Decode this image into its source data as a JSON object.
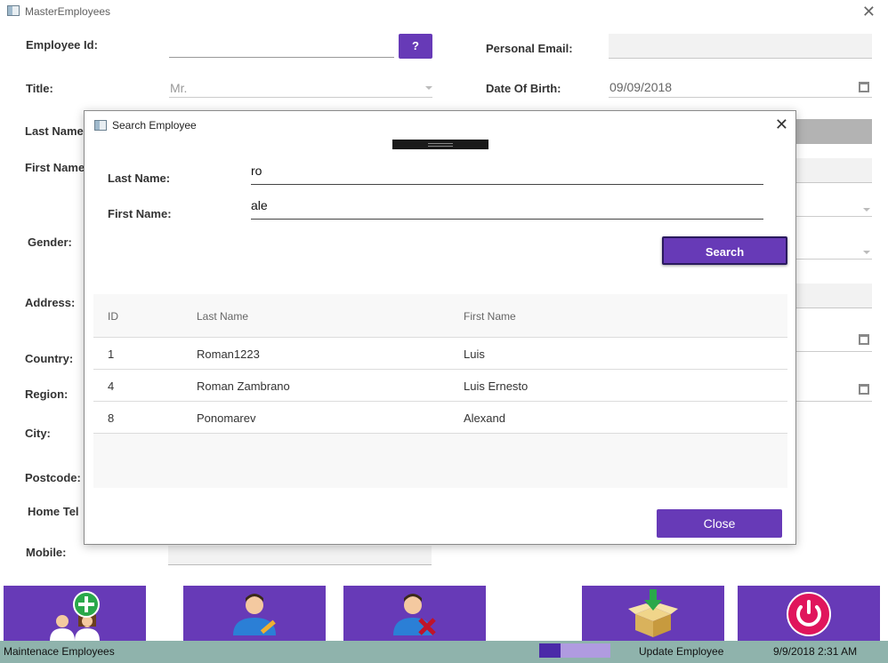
{
  "window": {
    "title": "MasterEmployees"
  },
  "form": {
    "employee_id_label": "Employee Id:",
    "lookup_button": "?",
    "title_label": "Title:",
    "title_value": "Mr.",
    "last_name_label": "Last Name",
    "first_name_label": "First Name",
    "gender_label": "Gender:",
    "address_label": "Address:",
    "country_label": "Country:",
    "region_label": "Region:",
    "city_label": "City:",
    "postcode_label": "Postcode:",
    "home_tel_label": "Home Tel",
    "mobile_label": "Mobile:",
    "personal_email_label": "Personal Email:",
    "dob_label": "Date Of Birth:",
    "dob_value": "09/09/2018"
  },
  "dialog": {
    "title": "Search Employee",
    "last_name_label": "Last Name:",
    "last_name_value": "ro",
    "first_name_label": "First Name:",
    "first_name_value": "ale",
    "search_button": "Search",
    "close_button": "Close",
    "columns": [
      "ID",
      "Last Name",
      "First Name"
    ],
    "rows": [
      [
        "1",
        "Roman1223",
        "Luis"
      ],
      [
        "4",
        "Roman Zambrano",
        "Luis Ernesto"
      ],
      [
        "8",
        "Ponomarev",
        "Alexand"
      ]
    ]
  },
  "toolbar": {
    "icons": [
      "add-users-icon",
      "edit-user-icon",
      "delete-user-icon",
      "save-package-icon",
      "power-icon"
    ]
  },
  "status": {
    "left_text": "Maintenace Employees",
    "action_text": "Update Employee",
    "datetime": "9/9/2018 2:31 AM",
    "progress": 0.3
  },
  "colors": {
    "accent": "#673ab7",
    "status_bar": "#8fb3ac"
  }
}
